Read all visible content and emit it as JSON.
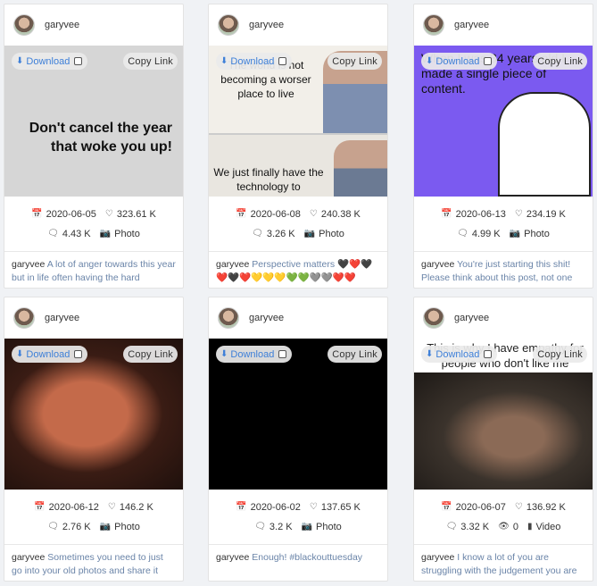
{
  "labels": {
    "download": "Download",
    "copy_link": "Copy Link"
  },
  "posts": [
    {
      "username": "garyvee",
      "date": "2020-06-05",
      "likes": "323.61 K",
      "comments": "4.43 K",
      "type": "Photo",
      "caption": "A lot of anger towards this year but in life often having the hard",
      "media_text": "Don't cancel the year that woke you up!",
      "media_bg": "#d6d6d6"
    },
    {
      "username": "garyvee",
      "date": "2020-06-08",
      "likes": "240.38 K",
      "comments": "3.26 K",
      "type": "Photo",
      "caption": "Perspective matters 🖤❤️🖤❤️🖤❤️💛💛💛💚💚🩶🩶❤️❤️",
      "media_text_top": "The world is not becoming a worser place to live",
      "media_text_bottom": "We just finally have the technology to",
      "media_bg": "#e9e6e0"
    },
    {
      "username": "garyvee",
      "date": "2020-06-13",
      "likes": "234.19 K",
      "comments": "4.99 K",
      "type": "Photo",
      "caption": "You're just starting this shit! Please think about this post, not one",
      "media_text": "When I was 34 years old I made a single piece of content.",
      "media_bg": "#7b5af0"
    },
    {
      "username": "garyvee",
      "date": "2020-06-12",
      "likes": "146.2 K",
      "comments": "2.76 K",
      "type": "Photo",
      "caption": "Sometimes you need to just go into your old photos and share it",
      "media_bg": "#5a2a1a"
    },
    {
      "username": "garyvee",
      "date": "2020-06-02",
      "likes": "137.65 K",
      "comments": "3.2 K",
      "type": "Photo",
      "caption": "Enough! #blackouttuesday",
      "media_bg": "#000000"
    },
    {
      "username": "garyvee",
      "date": "2020-06-07",
      "likes": "136.92 K",
      "comments": "3.32 K",
      "views": "0",
      "type": "Video",
      "caption": "I know a lot of you are struggling with the judgement you are",
      "media_text": "This is why I have empathy for people who don't like me",
      "media_bg": "#2b2520"
    }
  ]
}
